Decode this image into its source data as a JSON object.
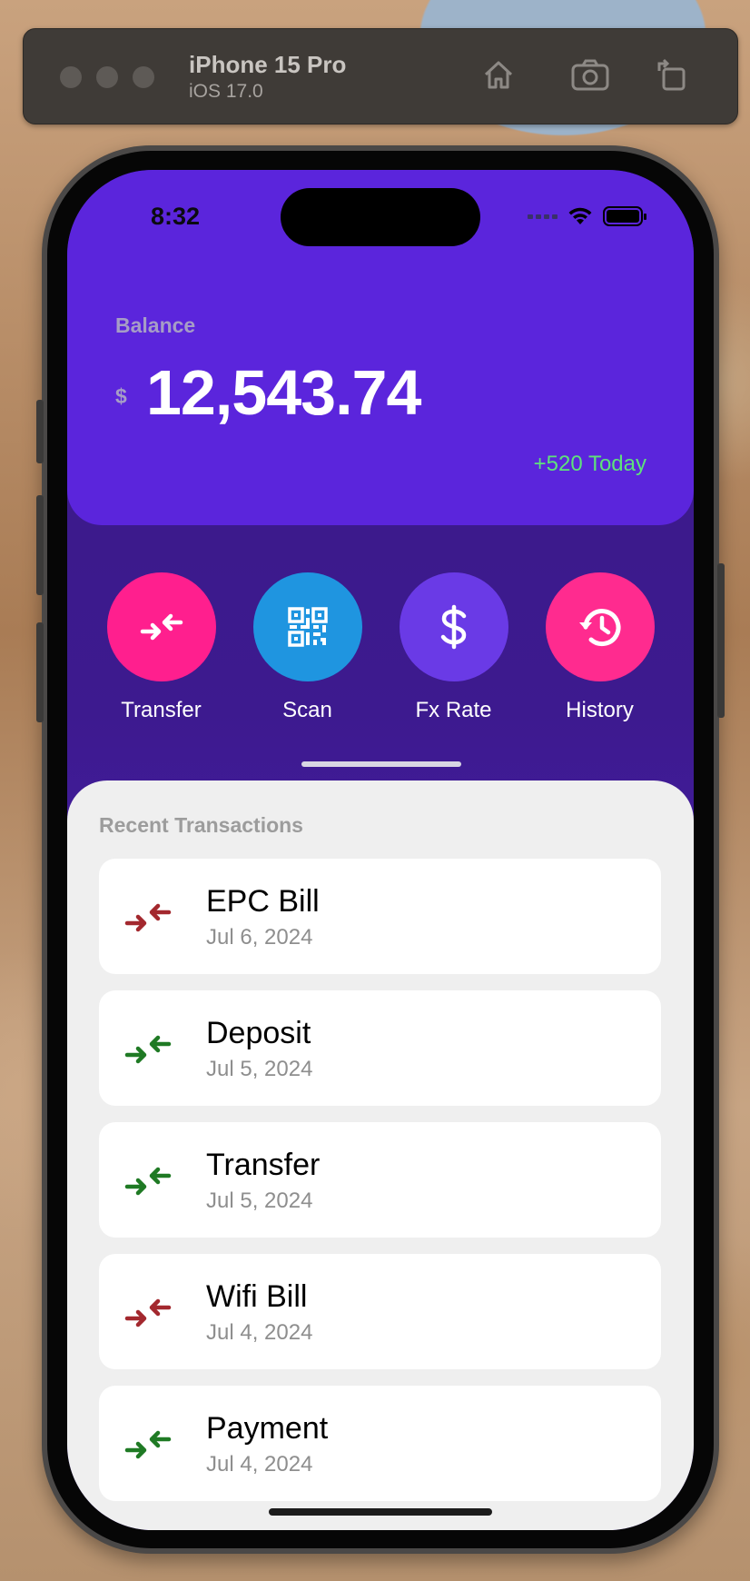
{
  "simulator": {
    "device_name": "iPhone 15 Pro",
    "os_version": "iOS 17.0",
    "icons": [
      "home-icon",
      "screenshot-icon",
      "rotate-icon"
    ]
  },
  "status_bar": {
    "time": "8:32",
    "icons": [
      "cellular-icon",
      "wifi-icon",
      "battery-icon"
    ]
  },
  "balance": {
    "label": "Balance",
    "currency_symbol": "$",
    "amount": "12,543.74",
    "change": "+520 Today",
    "change_color": "#5ee27b"
  },
  "actions": [
    {
      "label": "Transfer",
      "icon": "transfer-arrows-icon",
      "color": "#ff1f8e"
    },
    {
      "label": "Scan",
      "icon": "qr-code-icon",
      "color": "#1f95e0"
    },
    {
      "label": "Fx Rate",
      "icon": "dollar-icon",
      "color": "#6a3ae6"
    },
    {
      "label": "History",
      "icon": "history-clock-icon",
      "color": "#ff2b8f"
    }
  ],
  "transactions": {
    "title": "Recent Transactions",
    "items": [
      {
        "name": "EPC Bill",
        "date": "Jul 6, 2024",
        "direction": "out",
        "color": "#a3282e"
      },
      {
        "name": "Deposit",
        "date": "Jul 5, 2024",
        "direction": "in",
        "color": "#1f7a24"
      },
      {
        "name": "Transfer",
        "date": "Jul 5, 2024",
        "direction": "in",
        "color": "#1f7a24"
      },
      {
        "name": "Wifi Bill",
        "date": "Jul 4, 2024",
        "direction": "out",
        "color": "#a3282e"
      },
      {
        "name": "Payment",
        "date": "Jul 4, 2024",
        "direction": "in",
        "color": "#1f7a24"
      }
    ]
  }
}
